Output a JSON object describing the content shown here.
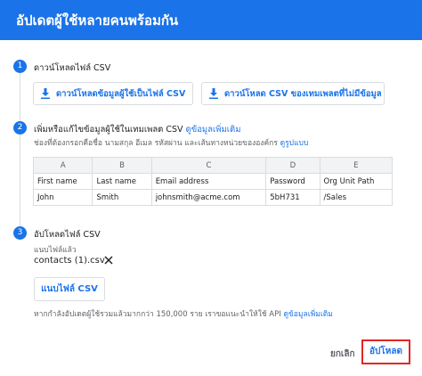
{
  "dialog": {
    "title": "อัปเดตผู้ใช้หลายคนพร้อมกัน"
  },
  "step1": {
    "number": "1",
    "title": "ดาวน์โหลดไฟล์ CSV",
    "btn_blank": "ดาวน์โหลดข้อมูลผู้ใช้เป็นไฟล์ CSV",
    "btn_template": "ดาวน์โหลด CSV ของเทมเพลตที่ไม่มีข้อมูล"
  },
  "step2": {
    "number": "2",
    "title": "เพิ่มหรือแก้ไขข้อมูลผู้ใช้ในเทมเพลต CSV",
    "title_link": "ดูข้อมูลเพิ่มเติม",
    "hint": "ช่องที่ต้องกรอกคือชื่อ นามสกุล อีเมล รหัสผ่าน และเส้นทางหน่วยขององค์กร",
    "hint_link": "ดูรูปแบบ",
    "table": {
      "letters": [
        "A",
        "B",
        "C",
        "D",
        "E"
      ],
      "headers": [
        "First name",
        "Last name",
        "Email address",
        "Password",
        "Org Unit Path"
      ],
      "row": [
        "John",
        "Smith",
        "johnsmith@acme.com",
        "5bH731",
        "/Sales"
      ]
    }
  },
  "step3": {
    "number": "3",
    "title": "อัปโหลดไฟล์ CSV",
    "attached_label": "แนบไฟล์แล้ว",
    "filename": "contacts (1).csv",
    "attach_btn": "แนบไฟล์ CSV",
    "note": "หากกำลังอัปเดตผู้ใช้รวมแล้วมากกว่า 150,000 ราย เราขอแนะนำให้ใช้ API",
    "note_link": "ดูข้อมูลเพิ่มเติม"
  },
  "actions": {
    "cancel": "ยกเลิก",
    "upload": "อัปโหลด"
  }
}
